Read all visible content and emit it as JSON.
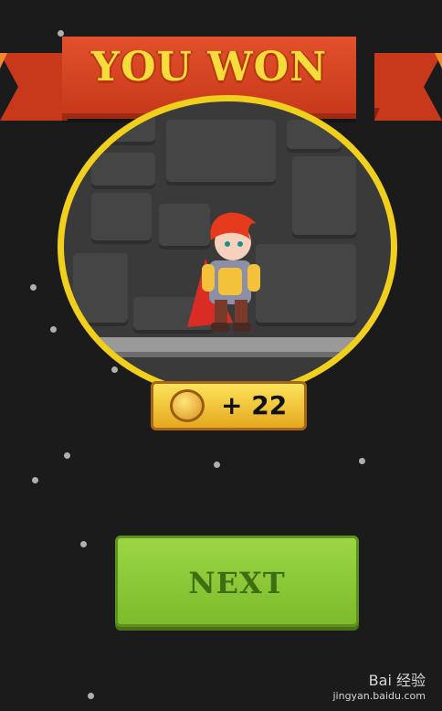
{
  "banner": {
    "title": "YOU WON"
  },
  "reward": {
    "amount": "+ 22",
    "icon": "coin-icon"
  },
  "actions": {
    "next_label": "NEXT"
  },
  "watermark": {
    "brand": "Bai 经验",
    "url": "jingyan.baidu.com"
  },
  "colors": {
    "banner": "#d94828",
    "banner_text": "#f7dd3b",
    "ring": "#f1cf1d",
    "next_button": "#8ccb39"
  }
}
